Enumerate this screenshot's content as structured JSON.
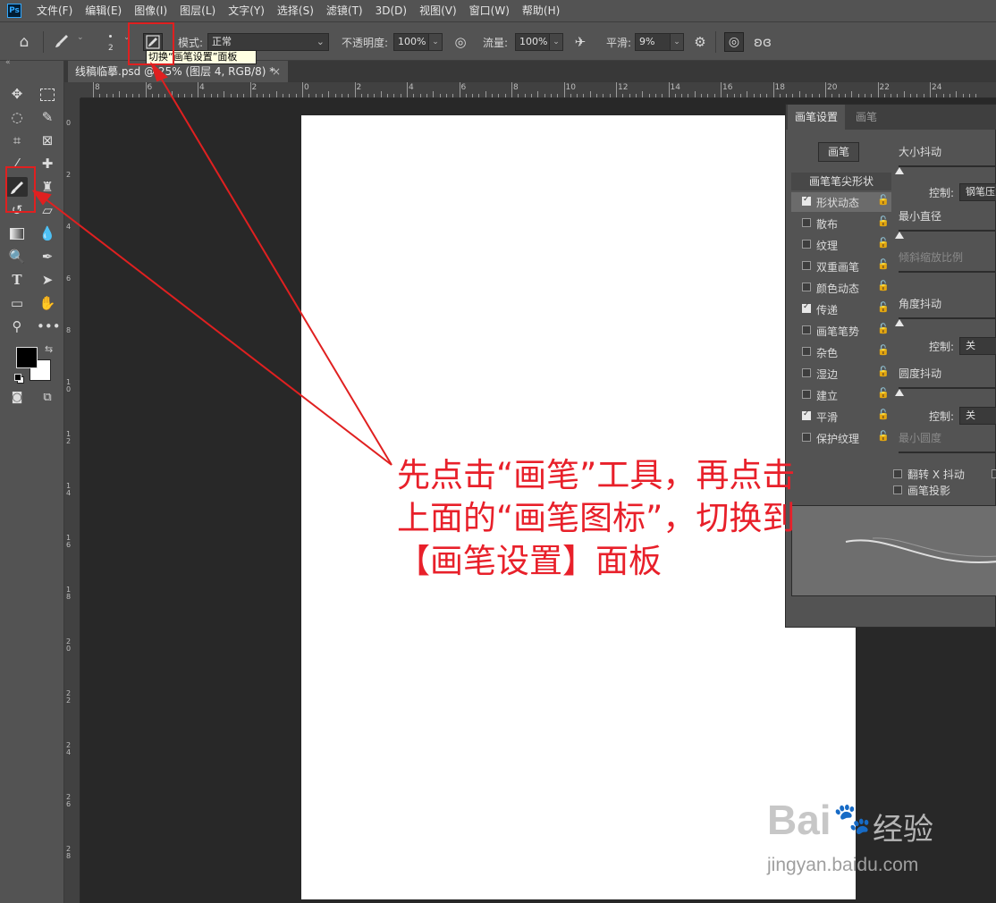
{
  "app": {
    "logo": "Ps",
    "menu": [
      "文件(F)",
      "编辑(E)",
      "图像(I)",
      "图层(L)",
      "文字(Y)",
      "选择(S)",
      "滤镜(T)",
      "3D(D)",
      "视图(V)",
      "窗口(W)",
      "帮助(H)"
    ]
  },
  "options_bar": {
    "brush_size": "2",
    "mode_label": "模式:",
    "mode_value": "正常",
    "opacity_label": "不透明度:",
    "opacity_value": "100%",
    "flow_label": "流量:",
    "flow_value": "100%",
    "smoothing_label": "平滑:",
    "smoothing_value": "9%",
    "tooltip": "切换“画笔设置”面板"
  },
  "document": {
    "tab_title": "线稿临摹.psd @ 25% (图层 4, RGB/8) *",
    "close": "×",
    "ruler_top_labels": [
      "8",
      "6",
      "4",
      "2",
      "0",
      "2",
      "4",
      "6",
      "8",
      "10",
      "12",
      "14",
      "16",
      "18",
      "20",
      "22",
      "24"
    ],
    "ruler_left_labels": [
      "0",
      "2",
      "4",
      "6",
      "8",
      "10",
      "12",
      "14",
      "16",
      "18",
      "20",
      "22",
      "24",
      "26",
      "28"
    ]
  },
  "brush_panel": {
    "tabs": [
      "画笔设置",
      "画笔"
    ],
    "brush_button": "画笔",
    "tip_shape": "画笔笔尖形状",
    "items": [
      {
        "label": "形状动态",
        "checked": true
      },
      {
        "label": "散布",
        "checked": false
      },
      {
        "label": "纹理",
        "checked": false
      },
      {
        "label": "双重画笔",
        "checked": false
      },
      {
        "label": "颜色动态",
        "checked": false
      },
      {
        "label": "传递",
        "checked": true
      },
      {
        "label": "画笔笔势",
        "checked": false
      },
      {
        "label": "杂色",
        "checked": false
      },
      {
        "label": "湿边",
        "checked": false
      },
      {
        "label": "建立",
        "checked": false
      },
      {
        "label": "平滑",
        "checked": true
      },
      {
        "label": "保护纹理",
        "checked": false
      }
    ],
    "size_jitter": "大小抖动",
    "control_label": "控制:",
    "control_value_1": "钢笔压力",
    "min_diameter": "最小直径",
    "tilt_scale": "倾斜缩放比例",
    "angle_jitter": "角度抖动",
    "control_value_2": "关",
    "roundness_jitter": "圆度抖动",
    "control_value_3": "关",
    "min_roundness": "最小圆度",
    "flip_x": "翻转 X 抖动",
    "brush_projection": "画笔投影"
  },
  "annotation": {
    "text": "先点击“画笔”工具，再点击\n上面的“画笔图标”，切换到\n【画笔设置】面板",
    "color": "#e8202a"
  },
  "watermark": {
    "brand": "Bai",
    "brand2": "经验",
    "url": "jingyan.baidu.com"
  }
}
